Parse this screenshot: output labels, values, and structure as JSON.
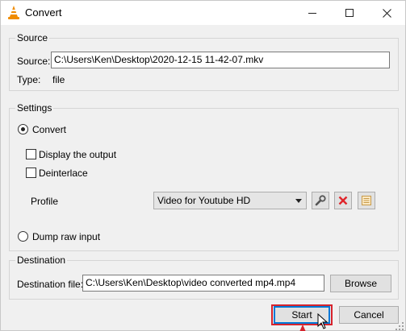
{
  "window": {
    "title": "Convert",
    "app_icon": "vlc-cone-icon",
    "controls": [
      "minimize-icon",
      "maximize-icon",
      "close-icon"
    ]
  },
  "source": {
    "group_title": "Source",
    "source_label": "Source:",
    "source_value": "C:\\Users\\Ken\\Desktop\\2020-12-15 11-42-07.mkv",
    "type_label": "Type:",
    "type_value": "file"
  },
  "settings": {
    "group_title": "Settings",
    "convert_label": "Convert",
    "convert_checked": true,
    "display_output_label": "Display the output",
    "display_output_checked": false,
    "deinterlace_label": "Deinterlace",
    "deinterlace_checked": false,
    "profile_label": "Profile",
    "profile_selected": "Video for Youtube HD",
    "profile_tools": [
      "wrench-icon",
      "delete-x-icon",
      "new-profile-icon"
    ],
    "dump_raw_label": "Dump raw input",
    "dump_raw_checked": false
  },
  "destination": {
    "group_title": "Destination",
    "file_label": "Destination file:",
    "file_value": "C:\\Users\\Ken\\Desktop\\video converted mp4.mp4",
    "browse_label": "Browse"
  },
  "buttons": {
    "start_label": "Start",
    "cancel_label": "Cancel"
  },
  "colors": {
    "highlight": "#d6232c",
    "delete_icon": "#e0242a",
    "vlc_orange": "#f08c00"
  }
}
